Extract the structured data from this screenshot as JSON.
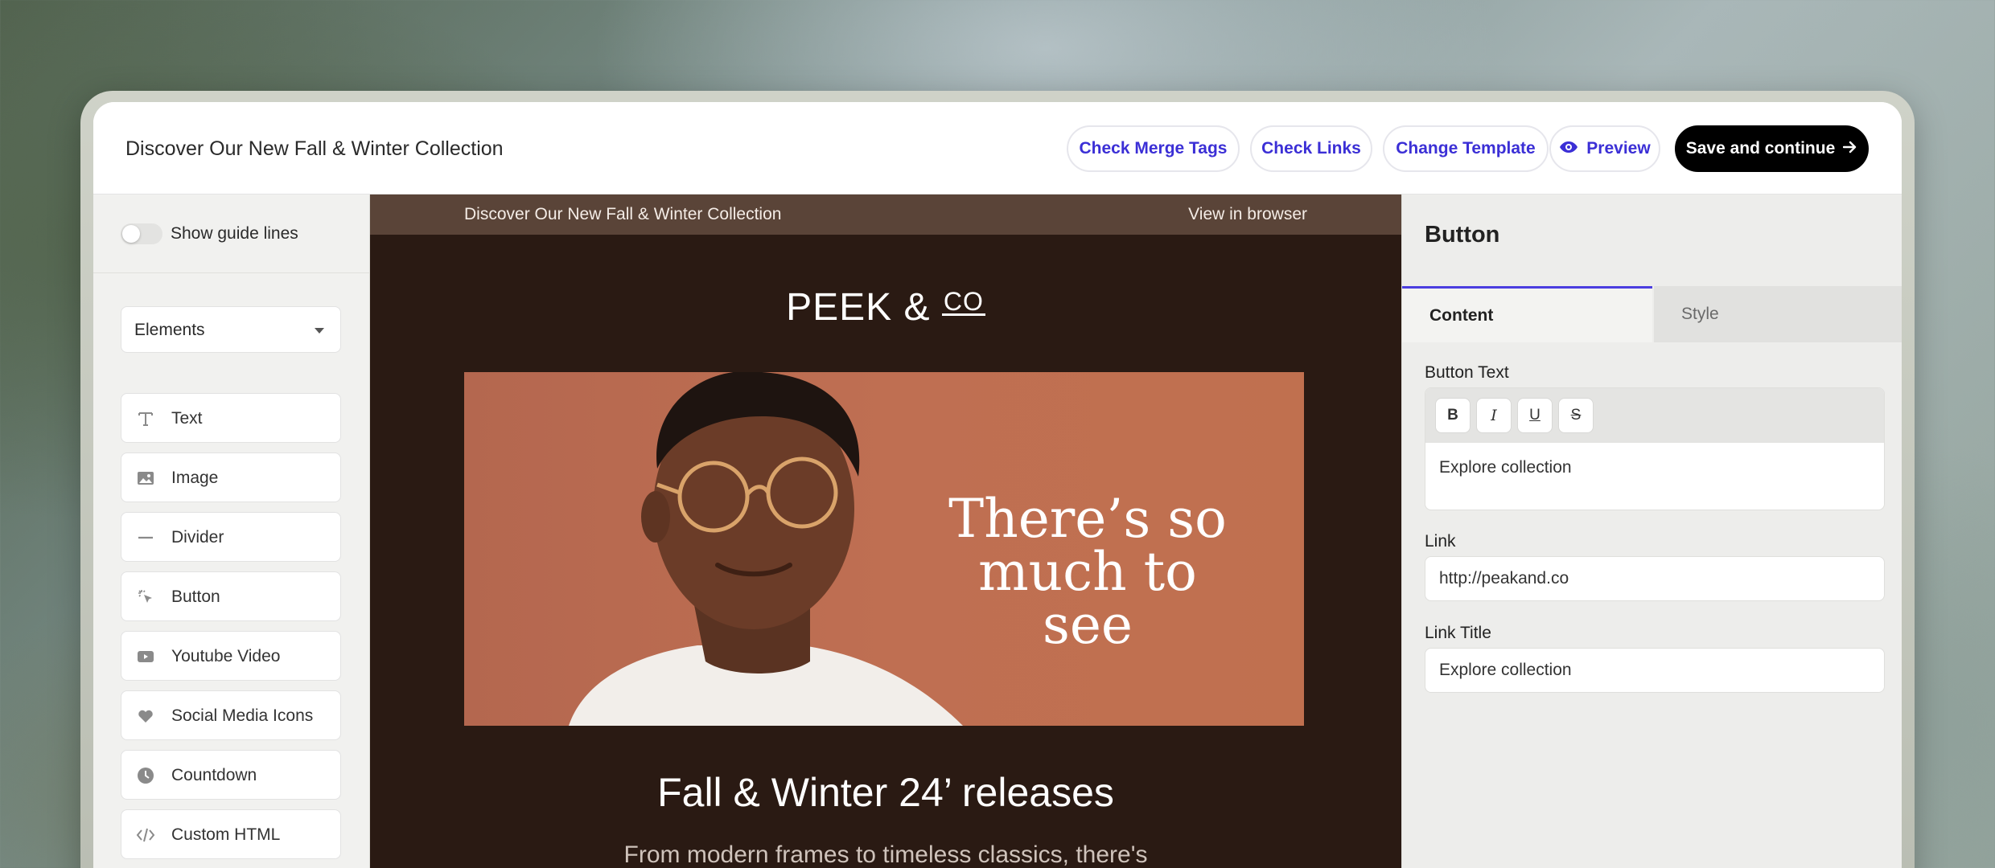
{
  "header": {
    "title": "Discover Our New Fall & Winter Collection",
    "buttons": {
      "check_merge_tags": "Check Merge Tags",
      "check_links": "Check Links",
      "change_template": "Change Template",
      "preview": "Preview",
      "save": "Save and continue"
    }
  },
  "left_panel": {
    "guide_lines_label": "Show guide lines",
    "dropdown_value": "Elements",
    "elements": [
      {
        "label": "Text",
        "icon": "text-icon"
      },
      {
        "label": "Image",
        "icon": "image-icon"
      },
      {
        "label": "Divider",
        "icon": "divider-icon"
      },
      {
        "label": "Button",
        "icon": "cursor-click-icon"
      },
      {
        "label": "Youtube Video",
        "icon": "video-icon"
      },
      {
        "label": "Social Media Icons",
        "icon": "heart-icon"
      },
      {
        "label": "Countdown",
        "icon": "clock-icon"
      },
      {
        "label": "Custom HTML",
        "icon": "code-icon"
      }
    ]
  },
  "email": {
    "preheader": "Discover Our New Fall & Winter Collection",
    "view_in_browser": "View in browser",
    "logo_main": "PEEK &",
    "logo_sup": "CO",
    "hero_line1": "There’s so",
    "hero_line2": "much to see",
    "headline": "Fall & Winter 24’ releases",
    "subline": "From modern frames to timeless classics, there's"
  },
  "right_panel": {
    "title": "Button",
    "tabs": {
      "content": "Content",
      "style": "Style"
    },
    "button_text_label": "Button Text",
    "button_text_value": "Explore collection",
    "link_label": "Link",
    "link_value": "http://peakand.co",
    "link_title_label": "Link Title",
    "link_title_value": "Explore collection"
  },
  "colors": {
    "accent": "#3b2fd6",
    "email_background": "#2a1a13",
    "hero_background": "#bf6f52"
  }
}
